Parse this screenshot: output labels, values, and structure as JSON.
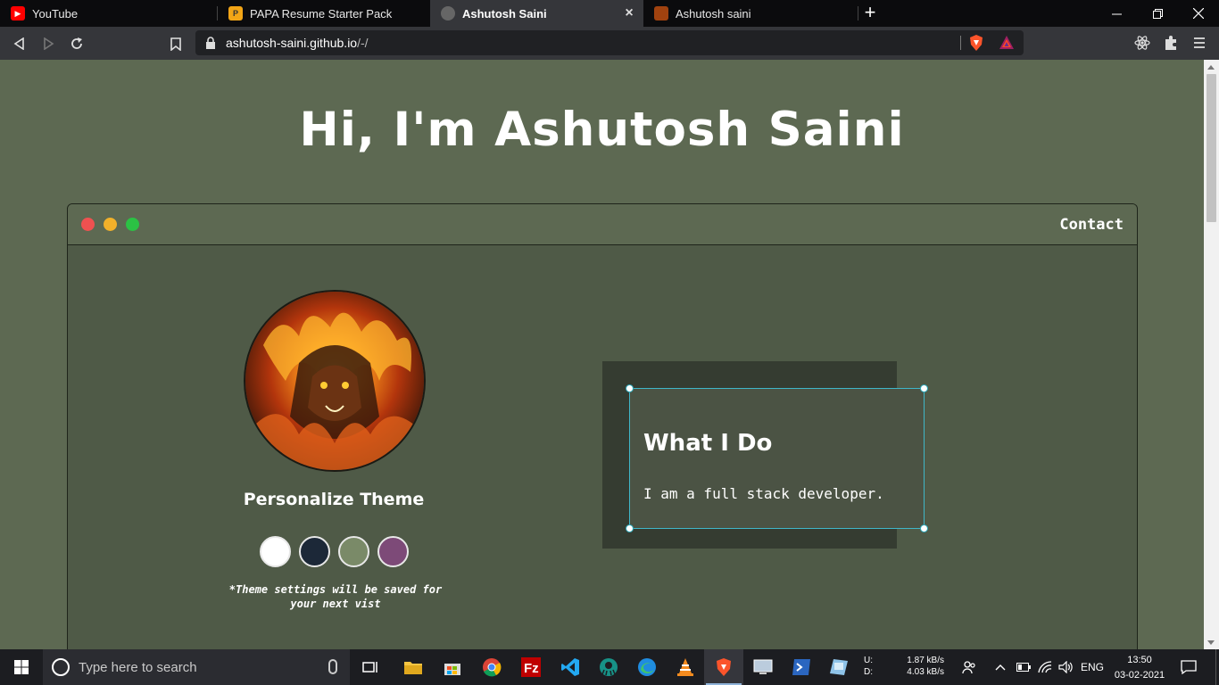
{
  "browser": {
    "tabs": [
      {
        "title": "YouTube",
        "active": false
      },
      {
        "title": "PAPA Resume Starter Pack",
        "active": false
      },
      {
        "title": "Ashutosh Saini",
        "active": true
      },
      {
        "title": "Ashutosh saini",
        "active": false
      }
    ],
    "new_tab_label": "+",
    "url_host": "ashutosh-saini.github.io",
    "url_path": "/-/"
  },
  "page": {
    "hero_title": "Hi, I'm Ashutosh Saini",
    "window_nav_contact": "Contact",
    "theme_title": "Personalize Theme",
    "theme_swatches": [
      {
        "name": "white",
        "color": "#ffffff"
      },
      {
        "name": "dark-navy",
        "color": "#1c2838"
      },
      {
        "name": "sage",
        "color": "#7a8a68"
      },
      {
        "name": "purple",
        "color": "#7d4a78"
      }
    ],
    "theme_note_line1": "*Theme settings will be saved for",
    "theme_note_line2": "your next vist",
    "what_title": "What I Do",
    "what_body": "I am a full stack developer."
  },
  "taskbar": {
    "search_placeholder": "Type here to search",
    "net_up_label": "U:",
    "net_down_label": "D:",
    "net_up_rate": "1.87 kB/s",
    "net_down_rate": "4.03 kB/s",
    "language": "ENG",
    "time": "13:50",
    "date": "03-02-2021"
  },
  "colors": {
    "page_bg": "#5d6952",
    "window_body": "#4f5a47",
    "card_outer": "#353c31",
    "card_inner": "#4b5344",
    "selection_border": "#3fb6c8",
    "traffic_red": "#ef5150",
    "traffic_yellow": "#f2b12a",
    "traffic_green": "#2bc244"
  }
}
